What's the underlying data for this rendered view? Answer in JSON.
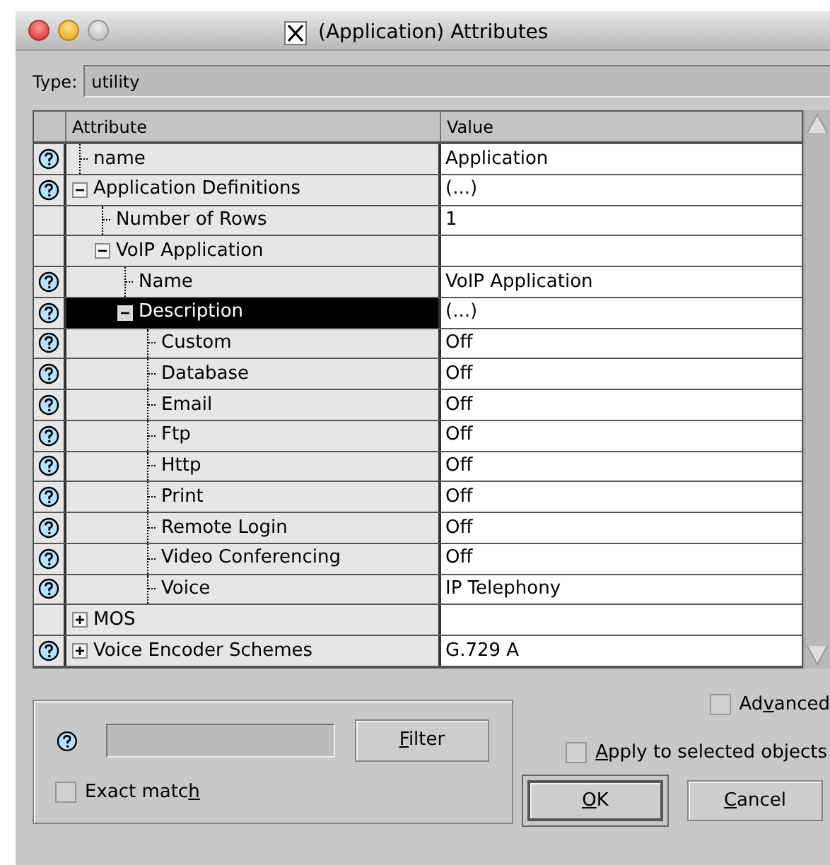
{
  "window": {
    "title": "(Application) Attributes"
  },
  "type_field": {
    "label": "Type:",
    "value": "utility"
  },
  "table": {
    "columns": [
      "Attribute",
      "Value"
    ],
    "rows": [
      {
        "name": "name",
        "value": "Application",
        "help": true,
        "selected": false
      },
      {
        "name": "Application Definitions",
        "value": "(...)",
        "help": true,
        "selected": false,
        "expanded": true,
        "children": [
          {
            "name": "Number of Rows",
            "value": "1",
            "help": false,
            "selected": false
          },
          {
            "name": "VoIP Application",
            "help": false,
            "selected": false,
            "expanded": true,
            "children": [
              {
                "name": "Name",
                "value": "VoIP Application",
                "help": true,
                "selected": false
              },
              {
                "name": "Description",
                "value": "(...)",
                "help": true,
                "selected": true,
                "expanded": true,
                "children": [
                  {
                    "name": "Custom",
                    "value": "Off",
                    "help": true,
                    "selected": false
                  },
                  {
                    "name": "Database",
                    "value": "Off",
                    "help": true,
                    "selected": false
                  },
                  {
                    "name": "Email",
                    "value": "Off",
                    "help": true,
                    "selected": false
                  },
                  {
                    "name": "Ftp",
                    "value": "Off",
                    "help": true,
                    "selected": false
                  },
                  {
                    "name": "Http",
                    "value": "Off",
                    "help": true,
                    "selected": false
                  },
                  {
                    "name": "Print",
                    "value": "Off",
                    "help": true,
                    "selected": false
                  },
                  {
                    "name": "Remote Login",
                    "value": "Off",
                    "help": true,
                    "selected": false
                  },
                  {
                    "name": "Video Conferencing",
                    "value": "Off",
                    "help": true,
                    "selected": false
                  },
                  {
                    "name": "Voice",
                    "value": "IP Telephony",
                    "help": true,
                    "selected": false
                  }
                ]
              }
            ]
          }
        ]
      },
      {
        "name": "MOS",
        "help": false,
        "selected": false,
        "expanded": false
      },
      {
        "name": "Voice Encoder Schemes",
        "value": "G.729 A",
        "help": true,
        "selected": false,
        "expanded": false
      }
    ]
  },
  "filter": {
    "button": {
      "key": "F",
      "after": "ilter"
    },
    "exact_match": {
      "before": "Exact matc",
      "key": "h",
      "checked": false
    }
  },
  "advanced": {
    "before": "Ad",
    "key": "v",
    "after": "anced",
    "checked": false
  },
  "apply_to_selected": {
    "key": "A",
    "after": "pply to selected objects",
    "checked": false
  },
  "buttons": [
    {
      "key": "O",
      "after": "K",
      "default": true
    },
    {
      "key": "C",
      "after": "ancel",
      "default": false
    }
  ]
}
